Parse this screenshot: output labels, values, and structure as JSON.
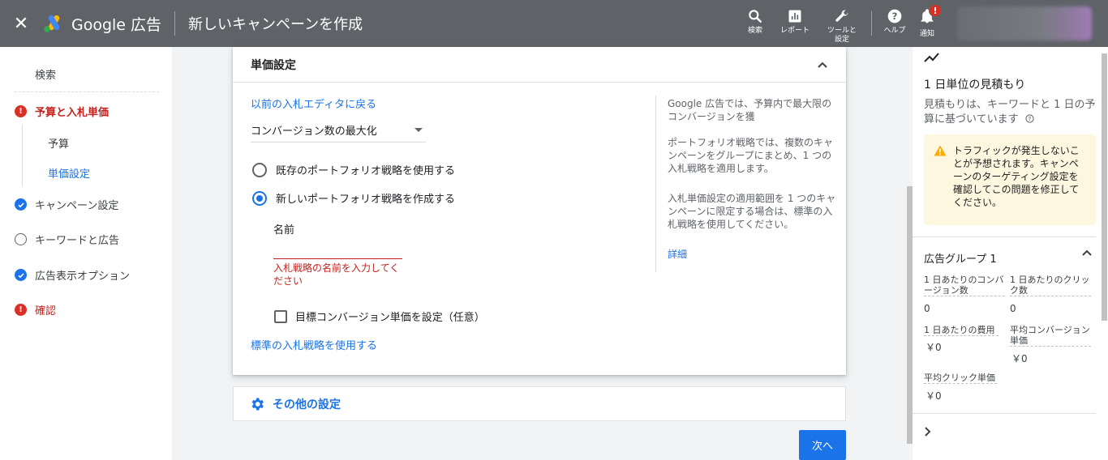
{
  "header": {
    "logo_text": "Google 広告",
    "page_title": "新しいキャンペーンを作成",
    "actions": [
      {
        "label": "検索",
        "icon": "search-icon"
      },
      {
        "label": "レポート",
        "icon": "reports-icon"
      },
      {
        "label": "ツールと設定",
        "icon": "wrench-icon"
      },
      {
        "label": "ヘルプ",
        "icon": "help-icon"
      },
      {
        "label": "通知",
        "icon": "bell-icon"
      }
    ],
    "notification_badge": "!"
  },
  "nav": {
    "search": "検索",
    "items": [
      {
        "label": "予算と入札単価",
        "status": "error"
      },
      {
        "label": "予算",
        "status": "sub"
      },
      {
        "label": "単価設定",
        "status": "sub-current"
      },
      {
        "label": "キャンペーン設定",
        "status": "done"
      },
      {
        "label": "キーワードと広告",
        "status": "todo"
      },
      {
        "label": "広告表示オプション",
        "status": "done"
      },
      {
        "label": "確認",
        "status": "error"
      }
    ],
    "error_glyph": "!"
  },
  "card": {
    "title": "単価設定",
    "back_link": "以前の入札エディタに戻る",
    "strategy_select": "コンバージョン数の最大化",
    "radio_existing": "既存のポートフォリオ戦略を使用する",
    "radio_new": "新しいポートフォリオ戦略を作成する",
    "name_label": "名前",
    "name_value": "",
    "name_error": "入札戦略の名前を入力してください",
    "target_cpa_checkbox": "目標コンバージョン単価を設定（任意）",
    "standard_link": "標準の入札戦略を使用する",
    "help": {
      "p1": "Google 広告では、予算内で最大限のコンバージョンを獲",
      "p2": "ポートフォリオ戦略では、複数のキャンペーンをグループにまとめ、1 つの入札戦略を適用します。",
      "p3": "入札単価設定の適用範囲を 1 つのキャンペーンに限定する場合は、標準の入札戦略を使用してください。",
      "more_link": "詳細"
    }
  },
  "other_settings": {
    "label": "その他の設定"
  },
  "next_button": "次へ",
  "right_panel": {
    "title": "1 日単位の見積もり",
    "subtitle": "見積もりは、キーワードと 1 日の予算に基づいています",
    "warning": "トラフィックが発生しないことが予想されます。キャンペーンのターゲティング設定を確認してこの問題を修正してください。",
    "ad_group_title": "広告グループ 1",
    "metrics": [
      {
        "label": "1 日あたりのコンバージョン数",
        "value": "0"
      },
      {
        "label": "1 日あたりのクリック数",
        "value": "0"
      },
      {
        "label": "1 日あたりの費用",
        "value": "￥0"
      },
      {
        "label": "平均コンバージョン単価",
        "value": "￥0"
      },
      {
        "label": "平均クリック単価",
        "value": "￥0"
      }
    ]
  },
  "colors": {
    "header_bg": "#5f6368",
    "accent_blue": "#1a73e8",
    "error_red": "#d93025",
    "warning_bg": "#fef7e0",
    "warning_icon": "#f9ab00"
  }
}
